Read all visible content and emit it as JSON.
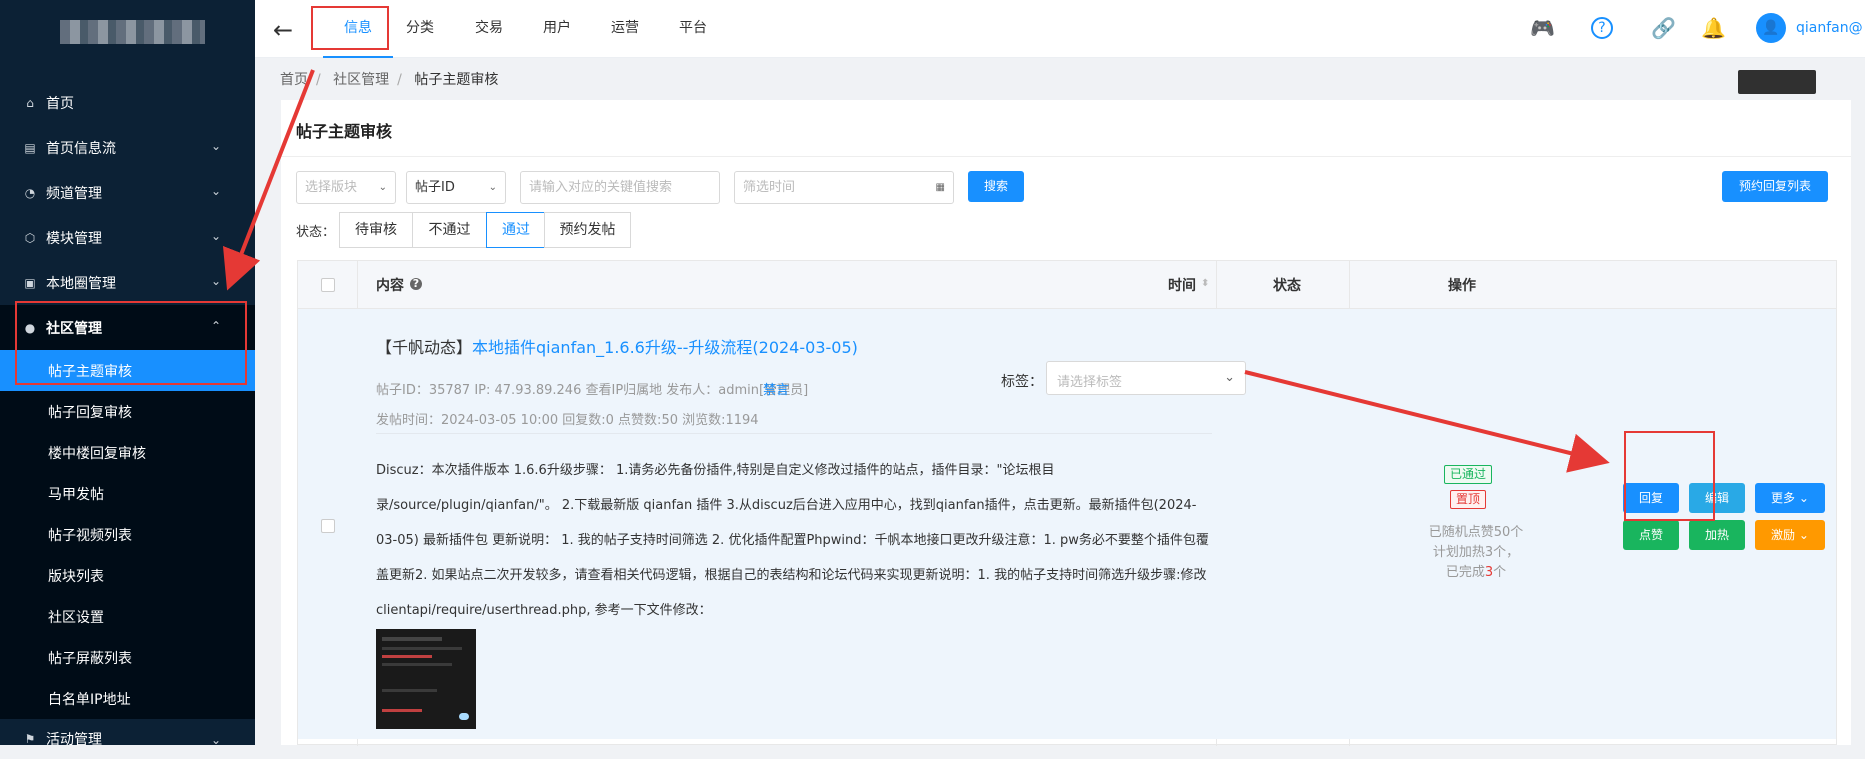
{
  "sidebar": {
    "items": [
      {
        "label": "首页",
        "icon": "home-icon",
        "chevron": false
      },
      {
        "label": "首页信息流",
        "icon": "list-icon",
        "chevron": true
      },
      {
        "label": "频道管理",
        "icon": "rss-icon",
        "chevron": true
      },
      {
        "label": "模块管理",
        "icon": "cube-icon",
        "chevron": true
      },
      {
        "label": "本地圈管理",
        "icon": "camera-icon",
        "chevron": true
      },
      {
        "label": "社区管理",
        "icon": "user-circle-icon",
        "chevron": true
      }
    ],
    "subitems": [
      "帖子主题审核",
      "帖子回复审核",
      "楼中楼回复审核",
      "马甲发帖",
      "帖子视频列表",
      "版块列表",
      "社区设置",
      "帖子屏蔽列表",
      "白名单IP地址"
    ],
    "bottom_item": "活动管理"
  },
  "topbar": {
    "tabs": [
      "信息",
      "分类",
      "交易",
      "用户",
      "运营",
      "平台"
    ],
    "user": "qianfan@",
    "avatar_glyph": "👤",
    "icons": [
      "gamepad-icon",
      "help-icon",
      "link-icon",
      "bell-icon"
    ]
  },
  "breadcrumb": [
    "首页",
    "社区管理",
    "帖子主题审核"
  ],
  "page": {
    "title": "帖子主题审核",
    "filters": {
      "board_placeholder": "选择版块",
      "field_value": "帖子ID",
      "keyword_placeholder": "请输入对应的关键值搜索",
      "time_placeholder": "筛选时间",
      "search_btn": "搜索",
      "schedule_btn": "预约回复列表"
    },
    "status_label": "状态：",
    "status_tabs": [
      "待审核",
      "不通过",
      "通过",
      "预约发帖"
    ],
    "active_status": "通过"
  },
  "table": {
    "headers": {
      "content": "内容",
      "time": "时间",
      "status": "状态",
      "ops": "操作"
    },
    "row": {
      "title_prefix": "【千帆动态】",
      "title_link": "本地插件qianfan_1.6.6升级--升级流程(2024-03-05)",
      "meta1": "帖子ID：35787    IP: 47.93.89.246 查看IP归属地    发布人：admin[管理员]",
      "ban": "禁言",
      "meta2": "发帖时间：2024-03-05 10:00    回复数:0 点赞数:50 浏览数:1194",
      "tag_label": "标签：",
      "tag_placeholder": "请选择标签",
      "body": "Discuz：本次插件版本 1.6.6升级步骤：   1.请务必先备份插件,特别是自定义修改过插件的站点，插件目录：\"论坛根目录/source/plugin/qianfan/\"。   2.下载最新版 qianfan 插件   3.从discuz后台进入应用中心，找到qianfan插件，点击更新。最新插件包(2024-03-05) 最新插件包  更新说明：   1. 我的帖子支持时间筛选   2. 优化插件配置Phpwind：千帆本地接口更改升级注意：1. pw务必不要整个插件包覆盖更新2. 如果站点二次开发较多，请查看相关代码逻辑，根据自己的表结构和论坛代码来实现更新说明：1. 我的帖子支持时间筛选升级步骤:修改clientapi/require/userthread.php, 参考一下文件修改：",
      "status_pass": "已通过",
      "status_top": "置顶",
      "stat1": "已随机点赞50个",
      "stat2": "计划加热3个，",
      "stat3_prefix": "已完成",
      "stat3_num": "3",
      "stat3_suffix": "个",
      "ops": {
        "reply": "回复",
        "edit": "编辑",
        "more": "更多",
        "like": "点赞",
        "heat": "加热",
        "incentive": "激励"
      }
    }
  },
  "colors": {
    "sidebar": "#0c2135",
    "accent": "#1890ff",
    "green": "#19b55e",
    "orange": "#ff9900",
    "annotation": "#e53935"
  }
}
